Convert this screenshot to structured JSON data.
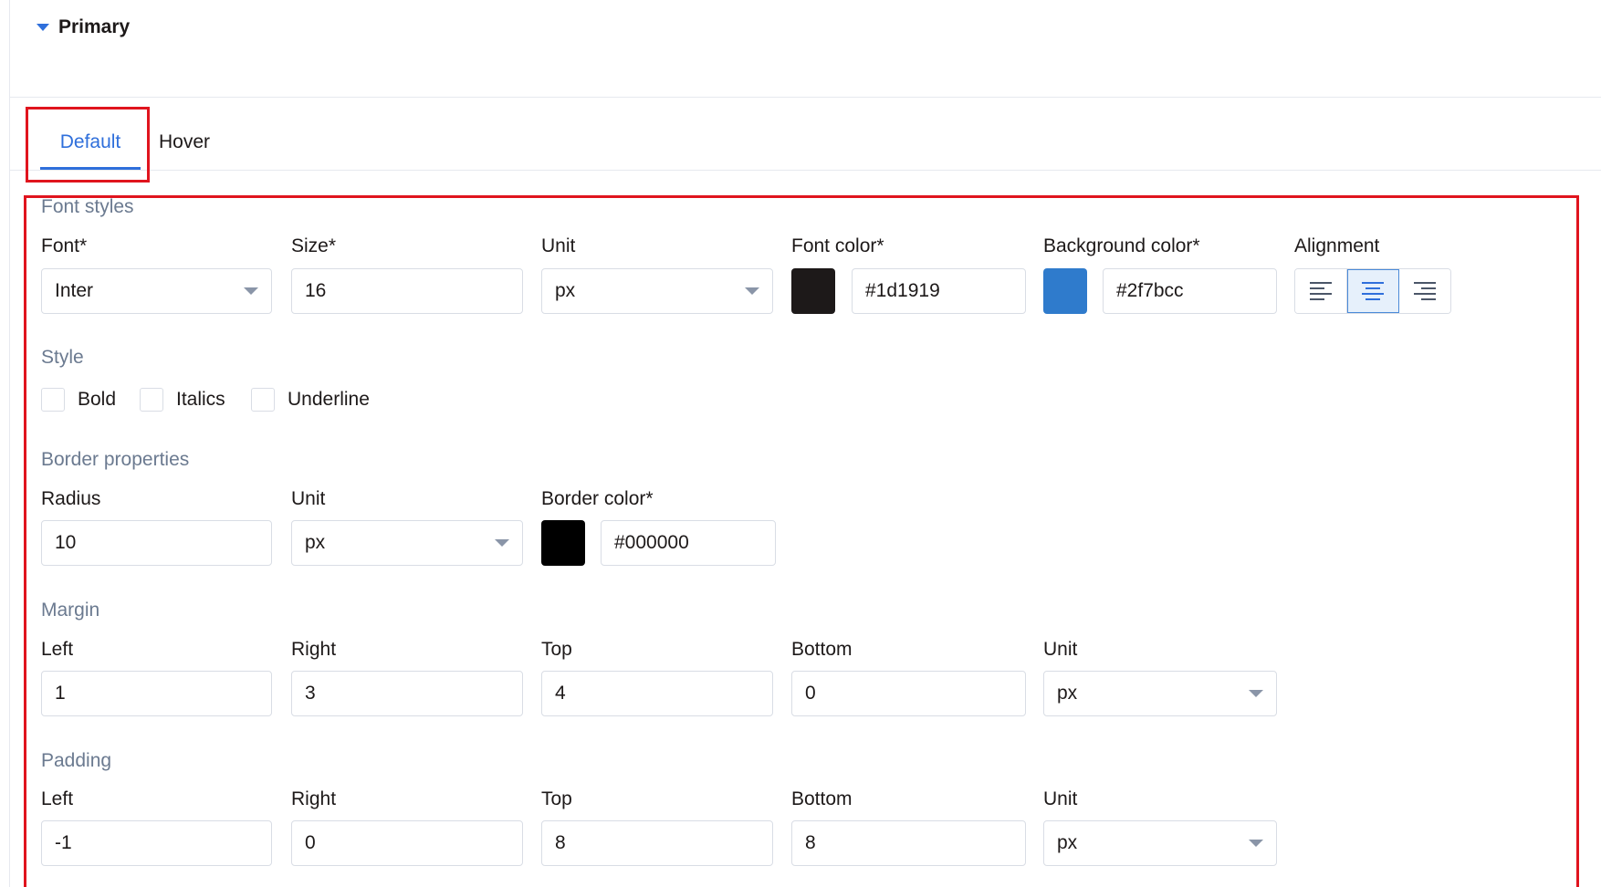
{
  "section": {
    "title": "Primary"
  },
  "tabs": [
    {
      "label": "Default",
      "active": true
    },
    {
      "label": "Hover",
      "active": false
    }
  ],
  "font_styles": {
    "title": "Font styles",
    "font": {
      "label": "Font*",
      "value": "Inter"
    },
    "size": {
      "label": "Size*",
      "value": "16"
    },
    "unit": {
      "label": "Unit",
      "value": "px"
    },
    "font_color": {
      "label": "Font color*",
      "value": "#1d1919",
      "swatch": "#1d1919"
    },
    "background_color": {
      "label": "Background color*",
      "value": "#2f7bcc",
      "swatch": "#2f7bcc"
    },
    "alignment": {
      "label": "Alignment",
      "options": [
        "align-left-icon",
        "align-center-icon",
        "align-right-icon"
      ],
      "selected": "center"
    }
  },
  "style": {
    "title": "Style",
    "options": [
      {
        "label": "Bold",
        "checked": false
      },
      {
        "label": "Italics",
        "checked": false
      },
      {
        "label": "Underline",
        "checked": false
      }
    ]
  },
  "border": {
    "title": "Border properties",
    "radius": {
      "label": "Radius",
      "value": "10"
    },
    "unit": {
      "label": "Unit",
      "value": "px"
    },
    "color": {
      "label": "Border color*",
      "value": "#000000",
      "swatch": "#000000"
    }
  },
  "margin": {
    "title": "Margin",
    "left": {
      "label": "Left",
      "value": "1"
    },
    "right": {
      "label": "Right",
      "value": "3"
    },
    "top": {
      "label": "Top",
      "value": "4"
    },
    "bottom": {
      "label": "Bottom",
      "value": "0"
    },
    "unit": {
      "label": "Unit",
      "value": "px"
    }
  },
  "padding": {
    "title": "Padding",
    "left": {
      "label": "Left",
      "value": "-1"
    },
    "right": {
      "label": "Right",
      "value": "0"
    },
    "top": {
      "label": "Top",
      "value": "8"
    },
    "bottom": {
      "label": "Bottom",
      "value": "8"
    },
    "unit": {
      "label": "Unit",
      "value": "px"
    }
  },
  "colors": {
    "accent": "#2f6fdb",
    "highlight": "#e0141e",
    "muted_text": "#6b7a90"
  }
}
